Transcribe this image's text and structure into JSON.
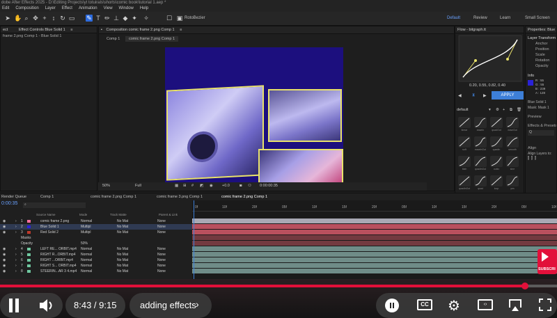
{
  "app": {
    "title": "dobe After Effects 2025 - D:\\Editing Projects\\yt totuirals\\shorts\\comic book\\tutorial 1.aep *",
    "menu": [
      "Edit",
      "Composition",
      "Layer",
      "Effect",
      "Animation",
      "View",
      "Window",
      "Help"
    ],
    "rotobezier_label": "RotoBezier",
    "workspaces": [
      "Default",
      "Review",
      "Learn",
      "Small Screen"
    ]
  },
  "effect_controls": {
    "tab_short": "ect",
    "tab": "Effect Controls Blue Solid 1",
    "sub": "frame 2.png Comp 1 - Blue Solid 1"
  },
  "composition": {
    "tab": "Composition comic frame 2.png Comp 1",
    "breadcrumbs": [
      "Comp 1",
      "comic frame 2.png Comp 1"
    ],
    "zoom": "50%",
    "resolution": "Full",
    "exposure": "+0.0",
    "timecode": "0:00:00:35"
  },
  "flow": {
    "title": "Flow - bitgraph.tt",
    "values": "0.20, 0.55, 0.82, 0.40",
    "apply_label": "APPLY",
    "preset_dropdown": "default",
    "preset_labels": [
      "linear",
      "easeIn",
      "quadOut",
      "easeOut",
      "soft",
      "easeInOut",
      "quadIn",
      "smooth",
      "blah",
      "quadInOut",
      "cubic",
      "sine",
      "quadInOut",
      "quad",
      "loop",
      "yes"
    ]
  },
  "properties": {
    "title": "Properties: Blue S",
    "section": "Layer Transform",
    "items": [
      "Anchor",
      "Position",
      "Scale",
      "Rotation",
      "Opacity"
    ],
    "info_title": "Info",
    "info_values": [
      "R : 55",
      "G : 55",
      "B : 239",
      "A : 128"
    ],
    "layer_name": "Blue Solid 1",
    "mask_name": "Mask: Mask 1",
    "preview": "Preview",
    "effects_presets": "Effects & Presets",
    "search_icon_label": "Q",
    "align": "Align",
    "align_to": "Align Layers to:"
  },
  "timeline": {
    "tabs": [
      "Render Queue",
      "Comp 1",
      "comic frame 2.png Comp 1",
      "comic frame 3.png Comp 1",
      "comic frame 2.png Comp 1"
    ],
    "timecode": "0:00:35",
    "columns": {
      "source": "Source Name",
      "mode": "Mode",
      "track": "Track Matte",
      "parent": "Parent & Link"
    },
    "ruler": [
      "0f",
      "10f",
      "20f",
      "05f",
      "10f",
      "15f",
      "20f",
      "05f",
      "10f",
      "15f",
      "20f",
      "05f",
      "10f"
    ],
    "layers": [
      {
        "num": "1",
        "name": "comic frame 2.png",
        "mode": "Normal",
        "matte": "No Mat",
        "parent": "None"
      },
      {
        "num": "2",
        "name": "Blue Solid 1",
        "mode": "Multipl",
        "matte": "No Mat",
        "parent": "None"
      },
      {
        "num": "3",
        "name": "Red Solid 2",
        "mode": "Multipl",
        "matte": "No Mat",
        "parent": "None"
      },
      {
        "num": "",
        "name": "Masks",
        "mode": "",
        "matte": "",
        "parent": ""
      },
      {
        "num": "",
        "name": "Opacity",
        "mode": "50%",
        "matte": "",
        "parent": ""
      },
      {
        "num": "4",
        "name": "LEFT RE... ORBIT.mp4",
        "mode": "Normal",
        "matte": "No Mat",
        "parent": "None"
      },
      {
        "num": "5",
        "name": "RIGHT R...ORBIT.mp4",
        "mode": "Normal",
        "matte": "No Mat",
        "parent": "None"
      },
      {
        "num": "6",
        "name": "RIGHT ...ORBIT.mp4",
        "mode": "Normal",
        "matte": "No Mat",
        "parent": "None"
      },
      {
        "num": "7",
        "name": "RIGHT S... ORBIT.mp4",
        "mode": "Normal",
        "matte": "No Mat",
        "parent": "None"
      },
      {
        "num": "8",
        "name": "STEERIN...AR 3 4.mp4",
        "mode": "Normal",
        "matte": "No Mat",
        "parent": "None"
      }
    ],
    "subscribe_label": "SUBSCRI"
  },
  "player": {
    "time_current": "8:43",
    "time_total": "9:15",
    "time_display": "8:43 / 9:15",
    "chapter": "adding effects",
    "progress": 0.943,
    "cc_label": "CC"
  },
  "colors": {
    "accent_blue": "#2d6cdf",
    "apply_button": "#3d7fd8",
    "comp_bg": "#1c0f7e",
    "comic_border": "#e9e26a",
    "youtube_red": "#e2103a"
  }
}
